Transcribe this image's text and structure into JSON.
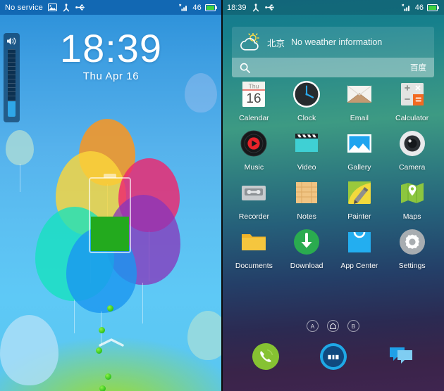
{
  "lockscreen": {
    "statusbar": {
      "carrier": "No service",
      "icons": [
        "screenshot-icon",
        "android-debug-icon",
        "usb-icon"
      ],
      "signal_icon": "signal-no-service-icon",
      "battery_percent": "46",
      "battery_icon": "battery-charging-icon"
    },
    "clock": {
      "time": "18:39",
      "date": "Thu  Apr 16"
    },
    "volume": {
      "icon": "speaker-icon",
      "level_percent": 23
    },
    "battery_overlay": {
      "fill_percent": 46,
      "fill_color": "#23aa1e"
    },
    "unlock_hint_icon": "chevron-up-icon",
    "wallpaper": "balloons-wallpaper"
  },
  "homescreen": {
    "statusbar": {
      "time": "18:39",
      "icons": [
        "android-debug-icon",
        "usb-icon"
      ],
      "signal_icon": "signal-no-service-icon",
      "battery_percent": "46",
      "battery_icon": "battery-charging-icon"
    },
    "widget": {
      "weather_icon": "sun-cloud-icon",
      "city": "北京",
      "info": "No weather information",
      "search_icon": "search-icon",
      "search_placeholder": "",
      "search_engine": "百度"
    },
    "apps": [
      [
        {
          "label": "Calendar",
          "icon": "calendar-icon",
          "day": "Thu",
          "date": "16"
        },
        {
          "label": "Clock",
          "icon": "clock-icon"
        },
        {
          "label": "Email",
          "icon": "email-icon"
        },
        {
          "label": "Calculator",
          "icon": "calculator-icon"
        }
      ],
      [
        {
          "label": "Music",
          "icon": "music-icon"
        },
        {
          "label": "Video",
          "icon": "video-icon"
        },
        {
          "label": "Gallery",
          "icon": "gallery-icon"
        },
        {
          "label": "Camera",
          "icon": "camera-icon"
        }
      ],
      [
        {
          "label": "Recorder",
          "icon": "recorder-icon"
        },
        {
          "label": "Notes",
          "icon": "notes-icon"
        },
        {
          "label": "Painter",
          "icon": "painter-icon"
        },
        {
          "label": "Maps",
          "icon": "maps-icon"
        }
      ],
      [
        {
          "label": "Documents",
          "icon": "documents-icon"
        },
        {
          "label": "Download",
          "icon": "download-icon"
        },
        {
          "label": "App Center",
          "icon": "app-center-icon"
        },
        {
          "label": "Settings",
          "icon": "settings-icon"
        }
      ]
    ],
    "page_indicators": [
      {
        "label": "A",
        "icon": "page-a-icon"
      },
      {
        "label": "",
        "icon": "home-page-icon"
      },
      {
        "label": "B",
        "icon": "page-b-icon"
      }
    ],
    "dock": [
      {
        "label": "Phone",
        "icon": "phone-icon"
      },
      {
        "label": "Browser",
        "icon": "meizu-browser-icon"
      },
      {
        "label": "Messaging",
        "icon": "messaging-icon"
      }
    ]
  },
  "colors": {
    "lock_status_bg": "#1268b3",
    "battery_green": "#23aa1e",
    "volume_fill": "#2fa7e8",
    "accent_teal": "#17788e"
  }
}
